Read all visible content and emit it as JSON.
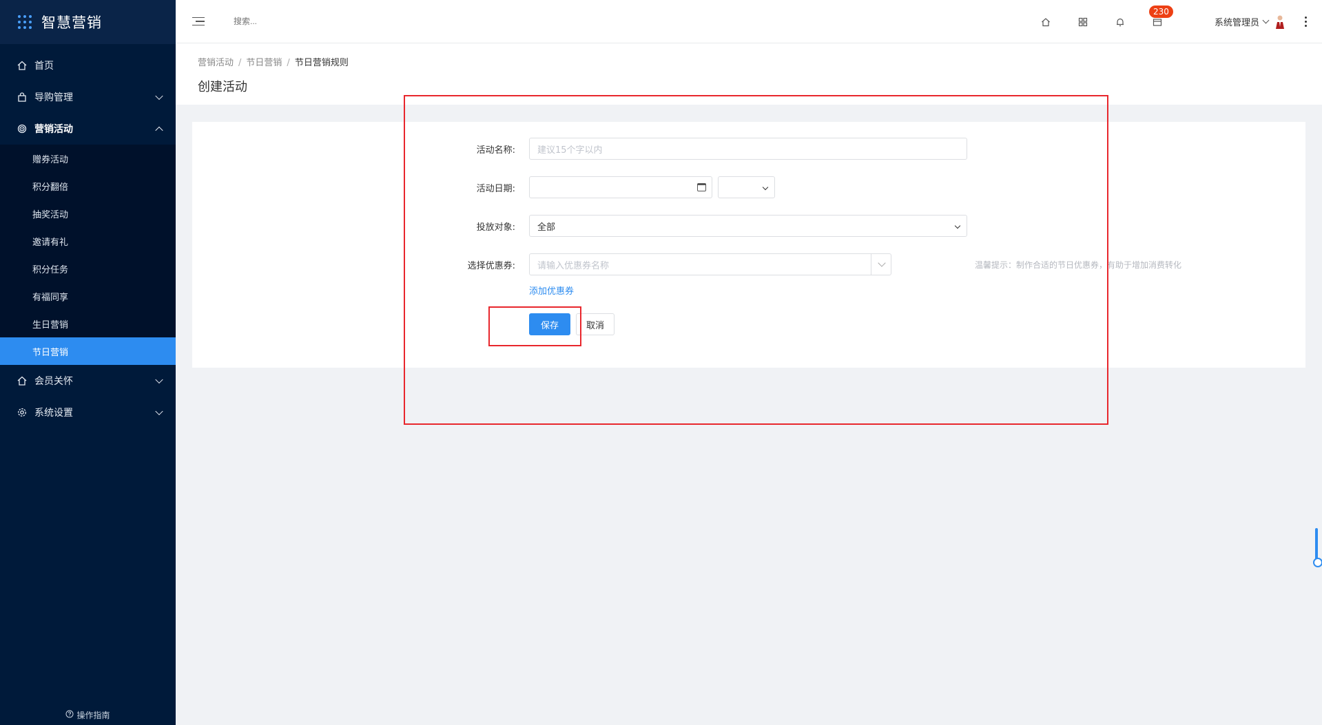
{
  "app": {
    "title": "智慧营销"
  },
  "sidebar": {
    "items": [
      {
        "label": "首页",
        "icon": "home-icon"
      },
      {
        "label": "导购管理",
        "icon": "bag-icon"
      },
      {
        "label": "营销活动",
        "icon": "target-icon"
      },
      {
        "label": "会员关怀",
        "icon": "house-icon"
      },
      {
        "label": "系统设置",
        "icon": "gear-icon"
      }
    ],
    "submenu": [
      "赠券活动",
      "积分翻倍",
      "抽奖活动",
      "邀请有礼",
      "积分任务",
      "有福同享",
      "生日营销",
      "节日营销"
    ],
    "active_sub": "节日营销",
    "guide": "操作指南"
  },
  "header": {
    "search_placeholder": "搜索...",
    "badge_count": "230",
    "user": "系统管理员"
  },
  "breadcrumb": [
    "营销活动",
    "节日营销",
    "节日营销规则"
  ],
  "page_title": "创建活动",
  "form": {
    "name_label": "活动名称:",
    "name_placeholder": "建议15个字以内",
    "date_label": "活动日期:",
    "target_label": "投放对象:",
    "target_value": "全部",
    "coupon_label": "选择优惠券:",
    "coupon_placeholder": "请输入优惠券名称",
    "tip": "温馨提示：制作合适的节日优惠券，有助于增加消费转化",
    "add_coupon": "添加优惠券",
    "save": "保存",
    "cancel": "取消"
  },
  "colors": {
    "primary": "#2d8cf0",
    "sidebar": "#001a3a",
    "annotation": "#e8262c",
    "badge": "#ed4014"
  }
}
